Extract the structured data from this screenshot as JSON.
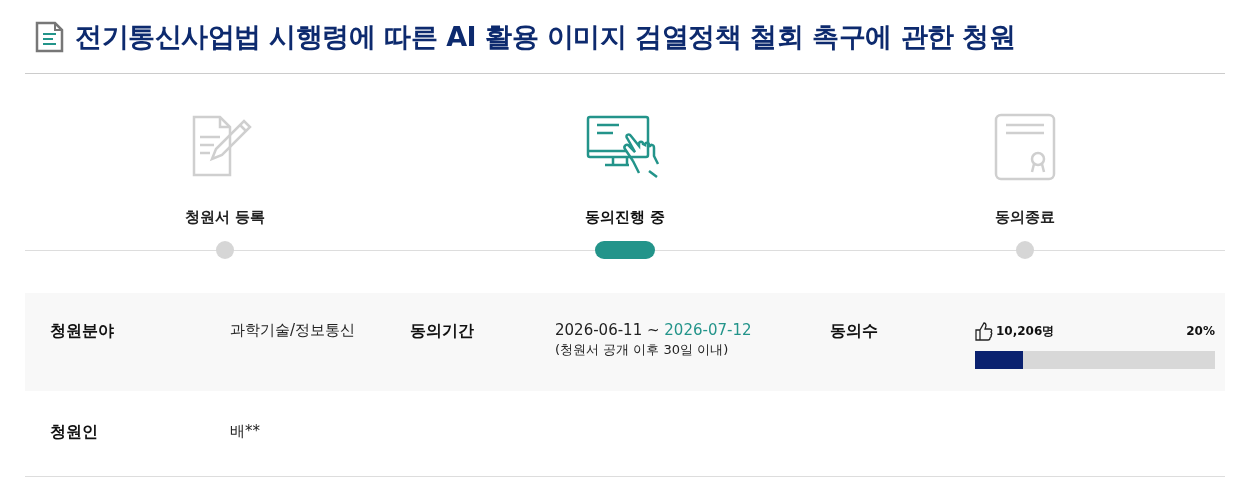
{
  "title": "전기통신사업법 시행령에 따른 AI 활용 이미지 검열정책 철회 촉구에 관한 청원",
  "steps": [
    {
      "kind": "register",
      "label": "청원서 등록",
      "active": false
    },
    {
      "kind": "consent",
      "label": "동의진행 중",
      "active": true
    },
    {
      "kind": "closed",
      "label": "동의종료",
      "active": false
    }
  ],
  "rows": [
    [
      {
        "kind": "text",
        "label": "청원분야",
        "value": "과학기술/정보통신"
      },
      {
        "kind": "period",
        "label": "동의기간",
        "start": "2026-06-11",
        "separator": "~",
        "end": "2026-07-12",
        "note": "(청원서 공개 이후 30일 이내)"
      },
      {
        "kind": "count",
        "label": "동의수",
        "count": "10,206명",
        "percent": "20%",
        "level": 0.2
      }
    ],
    [
      {
        "kind": "text",
        "label": "청원인",
        "value": "배**"
      }
    ]
  ]
}
